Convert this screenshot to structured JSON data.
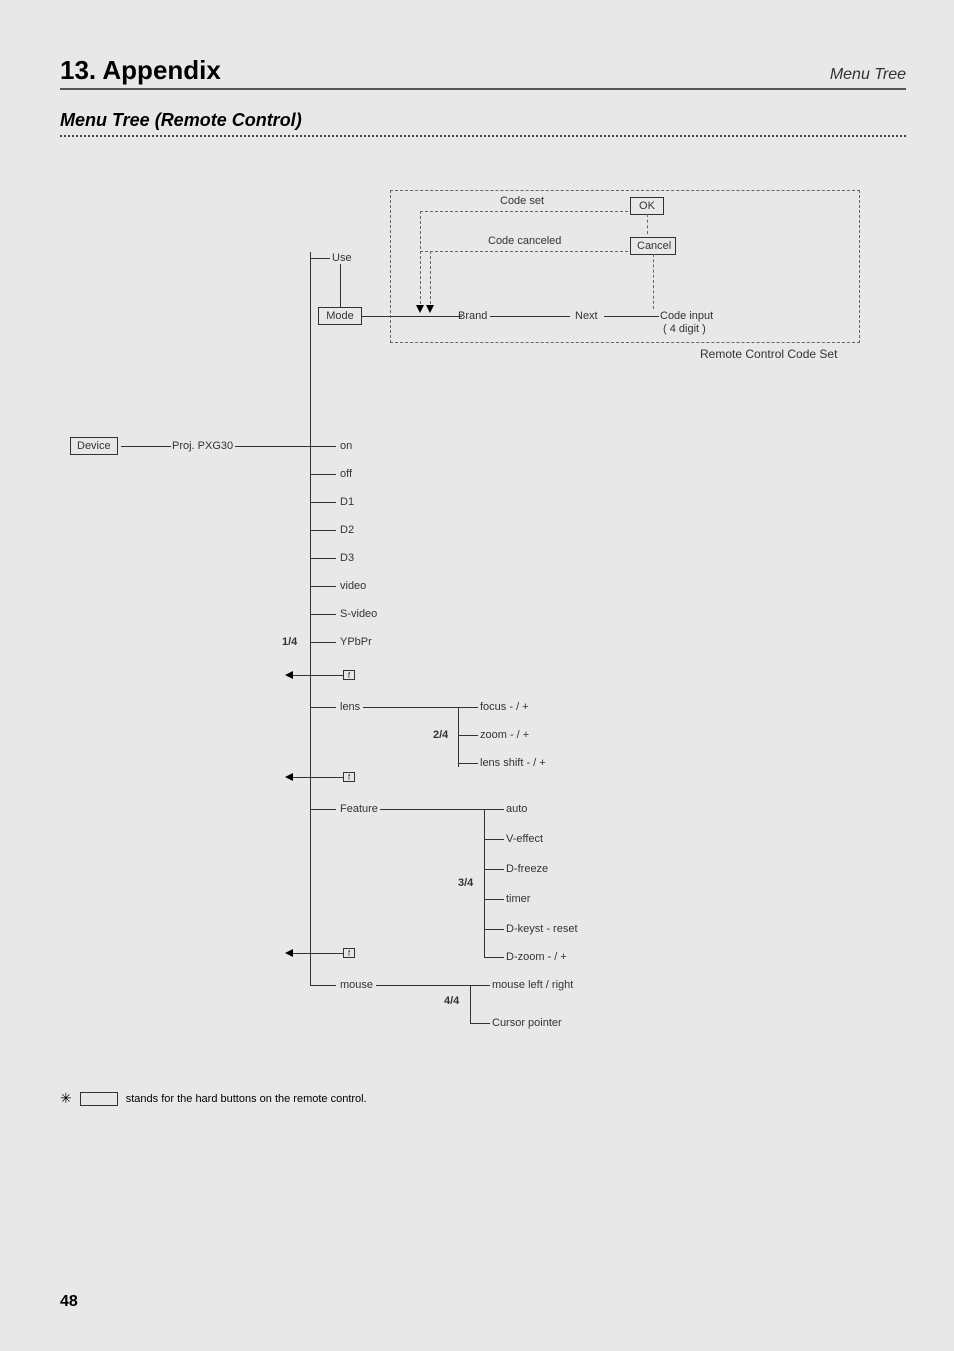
{
  "header": {
    "section": "13. Appendix",
    "right": "Menu Tree"
  },
  "subtitle": "Menu Tree (Remote Control)",
  "nodes": {
    "device": "Device",
    "proj": "Proj. PXG30",
    "use": "Use",
    "mode": "Mode",
    "codeset": "Code set",
    "codecanceled": "Code canceled",
    "ok": "OK",
    "cancel": "Cancel",
    "brand": "Brand",
    "next": "Next",
    "codeinput": "Code input",
    "codeinput_digits": "( 4 digit )",
    "rc_codeset": "Remote Control Code Set",
    "p1": "on",
    "p2": "off",
    "p3": "D1",
    "p4": "D2",
    "p5": "D3",
    "p6": "video",
    "p7": "S-video",
    "p8": "YPbPr",
    "group1": "1/4",
    "lens": "lens",
    "group2": "2/4",
    "l1": "focus - / +",
    "l2": "zoom - / +",
    "l3": "lens shift - / +",
    "feature": "Feature",
    "group3": "3/4",
    "f1": "auto",
    "f2": "V-effect",
    "f3": "D-freeze",
    "f4": "timer",
    "f5": "D-keyst  -  reset",
    "f6": "D-zoom - / +",
    "mouse": "mouse",
    "group4": "4/4",
    "m1": "mouse left / right",
    "m2": "Cursor pointer",
    "fchar": "f"
  },
  "footnote": {
    "symbol": "✳",
    "text": "stands for the hard buttons on the remote control."
  },
  "page_number": "48"
}
